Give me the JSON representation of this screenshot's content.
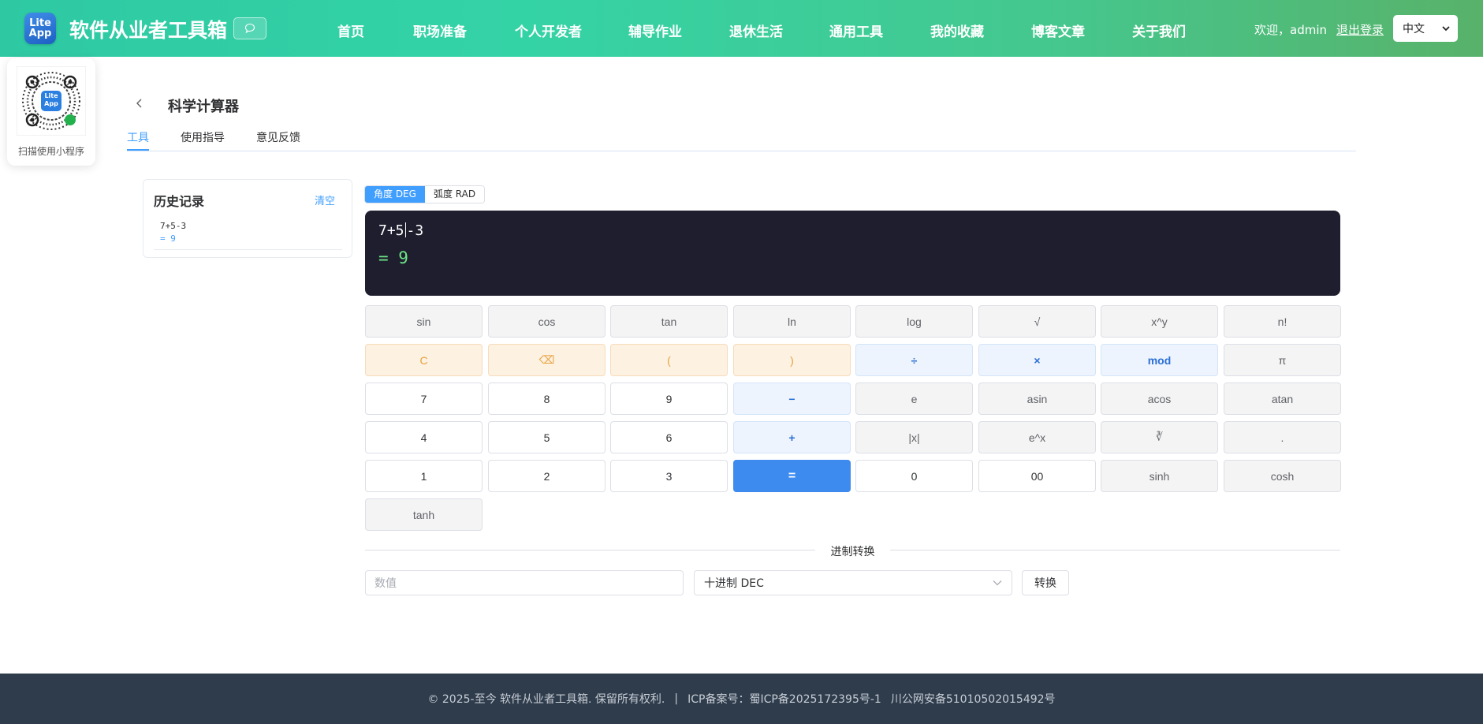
{
  "header": {
    "logo_line1": "Lite",
    "logo_line2": "App",
    "brand": "软件从业者工具箱",
    "nav": [
      "首页",
      "职场准备",
      "个人开发者",
      "辅导作业",
      "退休生活",
      "通用工具",
      "我的收藏",
      "博客文章",
      "关于我们"
    ],
    "welcome": "欢迎，admin",
    "logout": "退出登录",
    "language": "中文"
  },
  "qr": {
    "label": "扫描使用小程序",
    "logo_line1": "Lite",
    "logo_line2": "App"
  },
  "page": {
    "title": "科学计算器",
    "tabs": [
      "工具",
      "使用指导",
      "意见反馈"
    ],
    "active_tab": "工具"
  },
  "history": {
    "title": "历史记录",
    "clear": "清空",
    "items": [
      {
        "expr": "7+5-3",
        "result": "= 9"
      }
    ]
  },
  "mode": {
    "deg": "角度 DEG",
    "rad": "弧度 RAD",
    "active": "deg"
  },
  "display": {
    "expr_before_cursor": "7+5",
    "expr_after_cursor": "-3",
    "result": "= 9"
  },
  "keys": [
    [
      "sin",
      "cos",
      "tan",
      "ln",
      "log",
      "√",
      "x^y",
      "n!"
    ],
    [
      "C",
      "⌫",
      "(",
      ")",
      "÷",
      "×",
      "mod",
      "π"
    ],
    [
      "7",
      "8",
      "9",
      "−",
      "e",
      "asin",
      "acos",
      "atan"
    ],
    [
      "4",
      "5",
      "6",
      "+",
      "|x|",
      "e^x",
      "∛",
      "."
    ],
    [
      "1",
      "2",
      "3",
      "=",
      "0",
      "00",
      "sinh",
      "cosh"
    ],
    [
      "tanh"
    ]
  ],
  "key_styles": [
    [
      "fn",
      "fn",
      "fn",
      "fn",
      "fn",
      "fn",
      "fn",
      "fn"
    ],
    [
      "ctl",
      "ctl",
      "ctl",
      "ctl",
      "op",
      "op",
      "op",
      "fn"
    ],
    [
      "num",
      "num",
      "num",
      "op",
      "fn",
      "fn",
      "fn",
      "fn"
    ],
    [
      "num",
      "num",
      "num",
      "op",
      "fn",
      "fn",
      "fn",
      "fn"
    ],
    [
      "num",
      "num",
      "num",
      "eq",
      "num",
      "num",
      "fn",
      "fn"
    ],
    [
      "fn"
    ]
  ],
  "base_conversion": {
    "title": "进制转换",
    "input_placeholder": "数值",
    "base_selected": "十进制 DEC",
    "convert_label": "转换"
  },
  "footer": {
    "copyright": "© 2025-至今 软件从业者工具箱. 保留所有权利.",
    "separator": "|",
    "icp": "ICP备案号：蜀ICP备2025172395号-1",
    "police": "川公网安备51010502015492号"
  },
  "colors": {
    "header_start": "#2ec9a3",
    "header_end": "#58b26a",
    "accent": "#409eff",
    "display_bg": "#1e1e2e",
    "result_green": "#6ee787",
    "footer_bg": "#2f3c4c"
  }
}
